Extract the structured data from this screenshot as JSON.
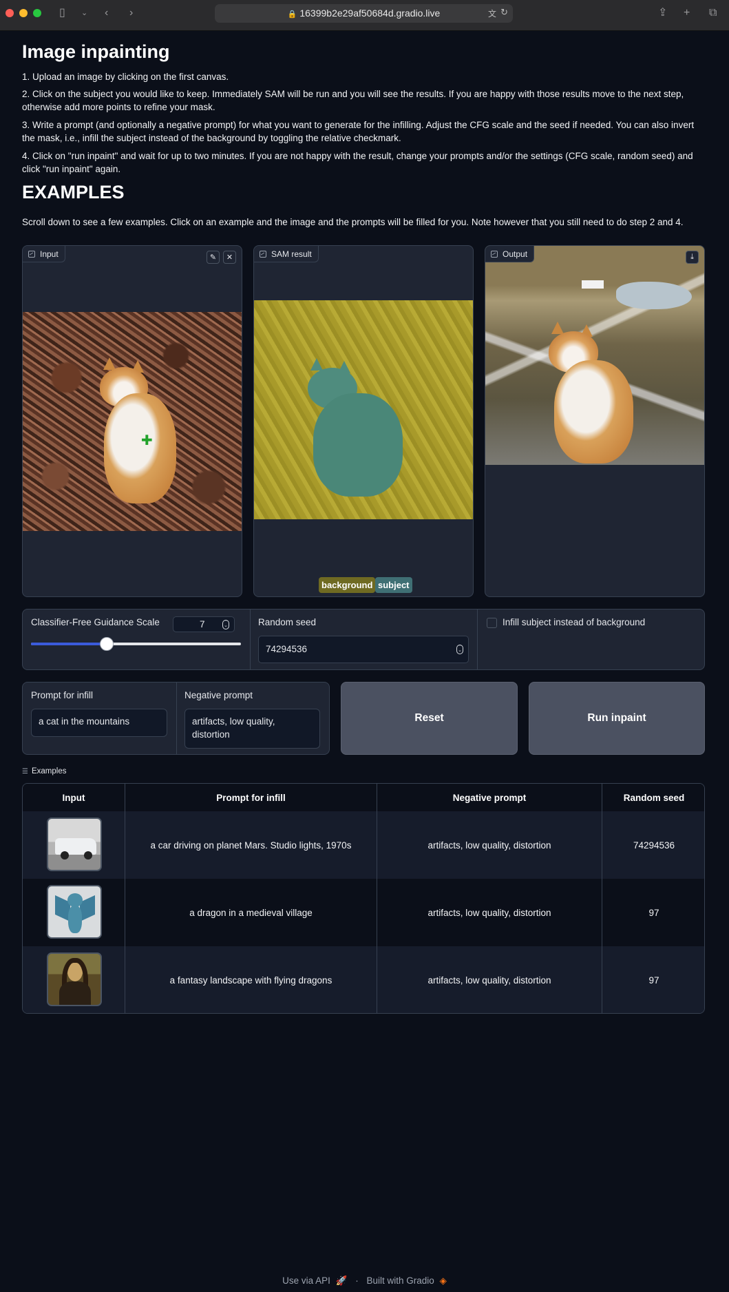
{
  "browser": {
    "url": "16399b2e29af50684d.gradio.live"
  },
  "header": {
    "title": "Image inpainting",
    "steps": [
      "1. Upload an image by clicking on the first canvas.",
      "2. Click on the subject you would like to keep. Immediately SAM will be run and you will see the results. If you are happy with those results move to the next step, otherwise add more points to refine your mask.",
      "3. Write a prompt (and optionally a negative prompt) for what you want to generate for the infilling. Adjust the CFG scale and the seed if needed. You can also invert the mask, i.e., infill the subject instead of the background by toggling the relative checkmark.",
      "4. Click on \"run inpaint\" and wait for up to two minutes. If you are not happy with the result, change your prompts and/or the settings (CFG scale, random seed) and click \"run inpaint\" again."
    ],
    "examples_heading": "EXAMPLES",
    "examples_note": "Scroll down to see a few examples. Click on an example and the image and the prompts will be filled for you. Note however that you still need to do step 2 and 4."
  },
  "panels": {
    "input_label": "Input",
    "sam_label": "SAM result",
    "output_label": "Output",
    "legend": [
      {
        "label": "background",
        "color": "#6f6a22"
      },
      {
        "label": "subject",
        "color": "#3f6f74"
      }
    ]
  },
  "controls": {
    "cfg_label": "Classifier-Free Guidance Scale",
    "cfg_value": "7",
    "cfg_fraction": 0.36,
    "seed_label": "Random seed",
    "seed_value": "74294536",
    "invert_label": "Infill subject instead of background",
    "invert_checked": false,
    "prompt_label": "Prompt for infill",
    "prompt_value": "a cat in the mountains",
    "negative_label": "Negative prompt",
    "negative_value": "artifacts, low quality, distortion",
    "reset_label": "Reset",
    "run_label": "Run inpaint"
  },
  "examples": {
    "title": "Examples",
    "columns": [
      "Input",
      "Prompt for infill",
      "Negative prompt",
      "Random seed"
    ],
    "rows": [
      {
        "thumb": "car",
        "prompt": "a car driving on planet Mars. Studio lights, 1970s",
        "negative": "artifacts, low quality, distortion",
        "seed": "74294536"
      },
      {
        "thumb": "dragon",
        "prompt": "a dragon in a medieval village",
        "negative": "artifacts, low quality, distortion",
        "seed": "97"
      },
      {
        "thumb": "mona-lisa",
        "prompt": "a fantasy landscape with flying dragons",
        "negative": "artifacts, low quality, distortion",
        "seed": "97"
      }
    ]
  },
  "footer": {
    "api_label": "Use via API",
    "separator": "·",
    "built_label": "Built with Gradio"
  }
}
